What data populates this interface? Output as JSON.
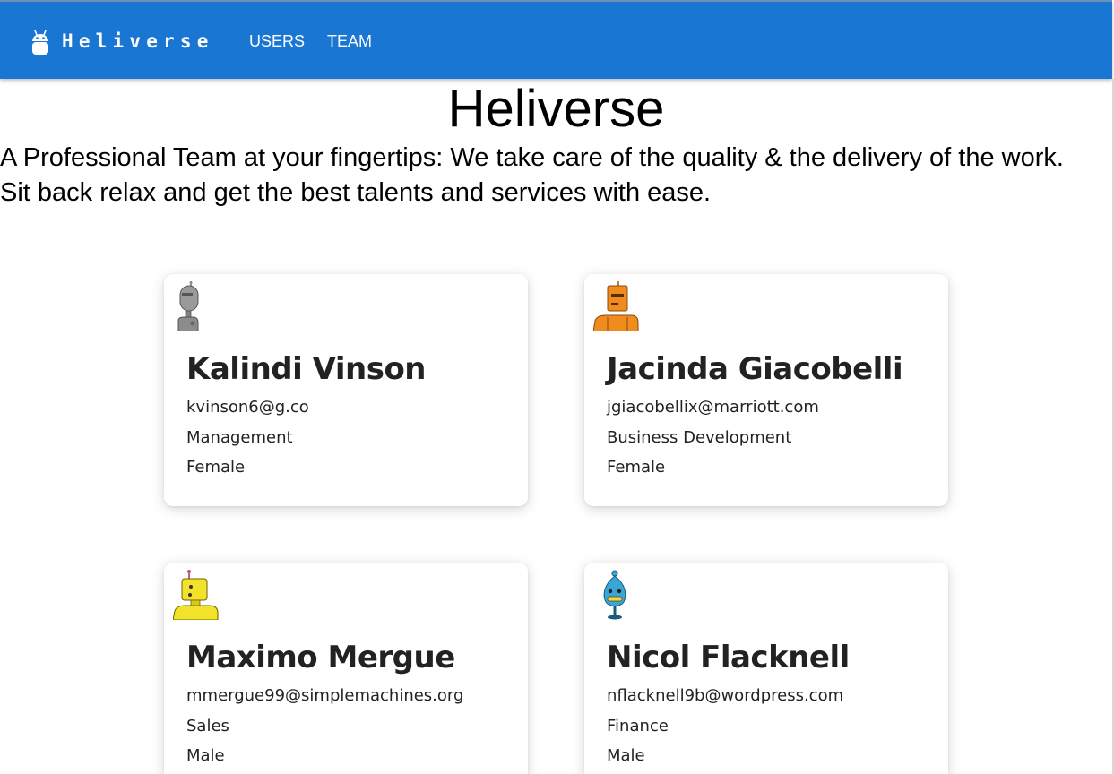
{
  "navbar": {
    "brand": "Heliverse",
    "links": [
      {
        "label": "USERS"
      },
      {
        "label": "TEAM"
      }
    ]
  },
  "hero": {
    "title": "Heliverse",
    "line1": "A Professional Team at your fingertips: We take care of the quality & the delivery of the work.",
    "line2": "Sit back relax and get the best talents and services with ease."
  },
  "cards": [
    {
      "name": "Kalindi Vinson",
      "email": "kvinson6@g.co",
      "domain": "Management",
      "gender": "Female",
      "avatar": "gray-robot-avatar"
    },
    {
      "name": "Jacinda Giacobelli",
      "email": "jgiacobellix@marriott.com",
      "domain": "Business Development",
      "gender": "Female",
      "avatar": "orange-robot-avatar"
    },
    {
      "name": "Maximo Mergue",
      "email": "mmergue99@simplemachines.org",
      "domain": "Sales",
      "gender": "Male",
      "avatar": "yellow-robot-avatar"
    },
    {
      "name": "Nicol Flacknell",
      "email": "nflacknell9b@wordpress.com",
      "domain": "Finance",
      "gender": "Male",
      "avatar": "blue-robot-avatar"
    }
  ],
  "colors": {
    "appbar": "#1976d2",
    "text": "#222222"
  }
}
